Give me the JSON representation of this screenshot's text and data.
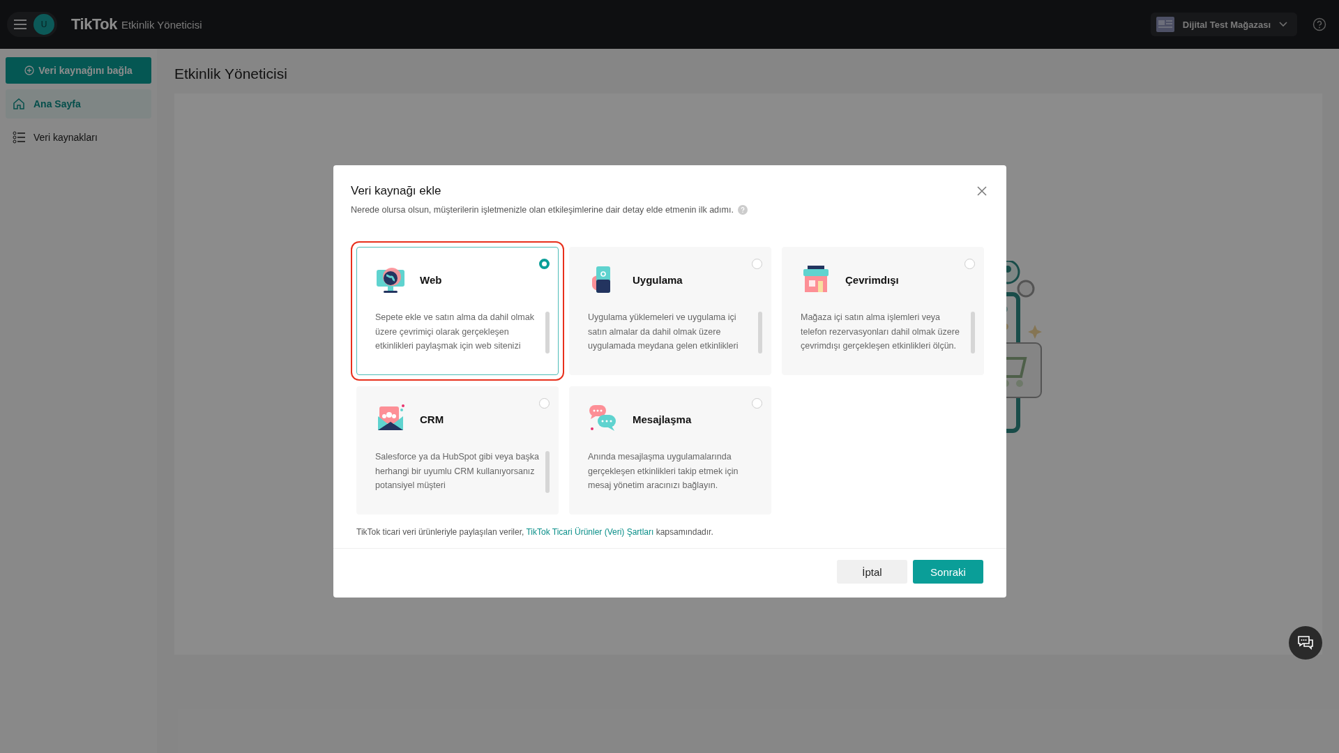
{
  "app_bar": {
    "brand": "TikTok",
    "product": "Etkinlik Yöneticisi",
    "avatar_letter": "U",
    "account": "Dijital Test Mağazası"
  },
  "sidebar": {
    "primary_button": "Veri kaynağını bağla",
    "items": [
      {
        "label": "Ana Sayfa",
        "selected": true,
        "kind": "home"
      },
      {
        "label": "Veri kaynakları",
        "selected": false,
        "kind": "list"
      }
    ]
  },
  "page": {
    "title": "Etkinlik Yöneticisi"
  },
  "dialog": {
    "title": "Veri kaynağı ekle",
    "subtitle": "Nerede olursa olsun, müşterilerin işletmenizle olan etkileşimlerine dair detay elde etmenin ilk adımı.",
    "options": [
      {
        "kind": "web",
        "title": "Web",
        "description": "Sepete ekle ve satın alma da dahil olmak üzere çevrimiçi olarak gerçekleşen etkinlikleri paylaşmak için web sitenizi",
        "scrollable": true,
        "selected": true
      },
      {
        "kind": "app",
        "title": "Uygulama",
        "description": "Uygulama yüklemeleri ve uygulama içi satın almalar da dahil olmak üzere uygulamada meydana gelen etkinlikleri",
        "scrollable": true,
        "selected": false
      },
      {
        "kind": "offline",
        "title": "Çevrimdışı",
        "description": "Mağaza içi satın alma işlemleri veya telefon rezervasyonları dahil olmak üzere çevrimdışı gerçekleşen etkinlikleri ölçün.",
        "scrollable": true,
        "selected": false
      },
      {
        "kind": "crm",
        "title": "CRM",
        "description": "Salesforce ya da HubSpot gibi veya başka herhangi bir uyumlu CRM kullanıyorsanız potansiyel müşteri",
        "scrollable": true,
        "selected": false
      },
      {
        "kind": "messaging",
        "title": "Mesajlaşma",
        "description": "Anında mesajlaşma uygulamalarında gerçekleşen etkinlikleri takip etmek için mesaj yönetim aracınızı bağlayın.",
        "scrollable": false,
        "selected": false
      }
    ],
    "notice_before": "TikTok ticari veri ürünleriyle paylaşılan veriler, ",
    "notice_link": "TikTok Ticari Ürünler (Veri) Şartları",
    "notice_after": " kapsamındadır.",
    "buttons": [
      {
        "label": "İptal",
        "kind": "secondary"
      },
      {
        "label": "Sonraki",
        "kind": "primary"
      }
    ]
  }
}
